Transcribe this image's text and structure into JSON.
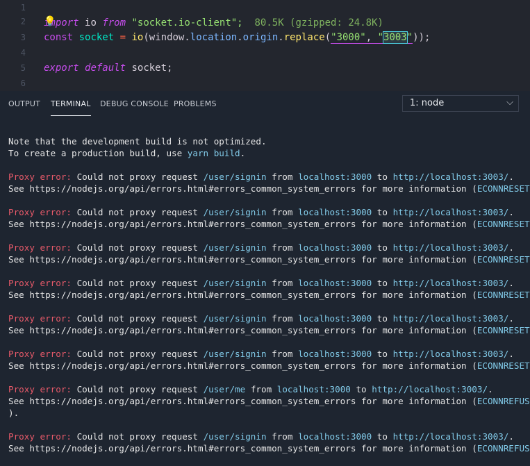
{
  "editor": {
    "lines": [
      {
        "n": "1"
      },
      {
        "n": "2"
      },
      {
        "n": "3"
      },
      {
        "n": "4"
      },
      {
        "n": "5"
      },
      {
        "n": "6"
      }
    ],
    "l1": {
      "import": "import",
      "name": "io",
      "from": "from",
      "module": "\"socket.io-client\";",
      "size_hint": "80.5K (gzipped: 24.8K)"
    },
    "l2": {
      "bulb": "💡"
    },
    "l3": {
      "const": "const",
      "var": "socket",
      "eq": "=",
      "fn": "io",
      "open": "(",
      "window": "window",
      "dot1": ".",
      "location": "location",
      "dot2": ".",
      "origin": "origin",
      "dot3": ".",
      "replace": "replace",
      "open2": "(",
      "a1": "\"3000\"",
      "comma": ", ",
      "q": "\"",
      "a2sel": "3003",
      "q2": "\"",
      "close": "));"
    },
    "l5": {
      "export": "export",
      "default": "default",
      "name": "socket;"
    }
  },
  "panel": {
    "tabs": [
      "OUTPUT",
      "TERMINAL",
      "DEBUG CONSOLE",
      "PROBLEMS"
    ],
    "active_tab": "TERMINAL",
    "terminal_select": "1: node",
    "terminal": {
      "intro1": "Note that the development build is not optimized.",
      "intro2_a": "To create a production build, use ",
      "intro2_b": "yarn build",
      "intro2_c": ".",
      "err_label": "Proxy error:",
      "mid1": " Could not proxy request ",
      "mid2": " from ",
      "mid3": " to ",
      "end": ".",
      "see_a": "See https://nodejs.org/api/errors.html#errors_common_system_errors for more information (",
      "errors": [
        {
          "path": "/user/signin",
          "host": "localhost:3000",
          "url": "http://localhost:3003/",
          "code": "ECONNRESET",
          "tail": ")."
        },
        {
          "path": "/user/signin",
          "host": "localhost:3000",
          "url": "http://localhost:3003/",
          "code": "ECONNRESET",
          "tail": ")."
        },
        {
          "path": "/user/signin",
          "host": "localhost:3000",
          "url": "http://localhost:3003/",
          "code": "ECONNRESET",
          "tail": ")."
        },
        {
          "path": "/user/signin",
          "host": "localhost:3000",
          "url": "http://localhost:3003/",
          "code": "ECONNRESET",
          "tail": ")."
        },
        {
          "path": "/user/signin",
          "host": "localhost:3000",
          "url": "http://localhost:3003/",
          "code": "ECONNRESET",
          "tail": ")."
        },
        {
          "path": "/user/signin",
          "host": "localhost:3000",
          "url": "http://localhost:3003/",
          "code": "ECONNRESET",
          "tail": ")."
        },
        {
          "path": "/user/me",
          "host": "localhost:3000",
          "url": "http://localhost:3003/",
          "code": "ECONNREFUSED",
          "tail": "",
          "wrap": ")."
        },
        {
          "path": "/user/signin",
          "host": "localhost:3000",
          "url": "http://localhost:3003/",
          "code": "ECONNREFUSED",
          "tail": ")."
        }
      ]
    }
  }
}
